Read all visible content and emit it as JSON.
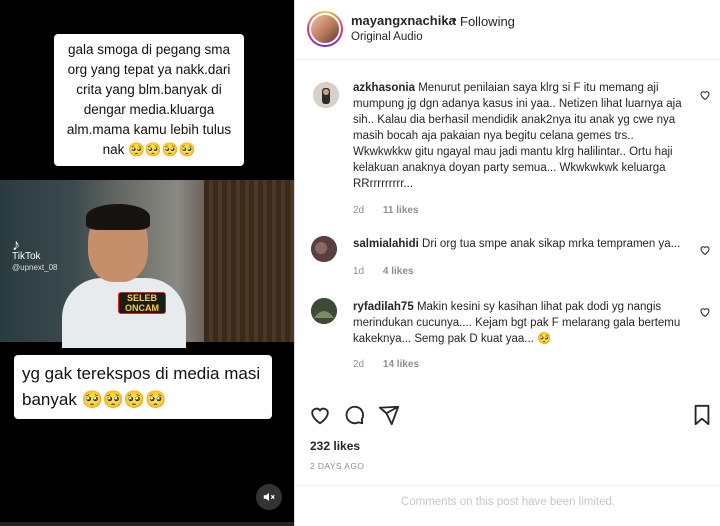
{
  "video": {
    "caption_top": "gala smoga di pegang sma org yang tepat ya nakk.dari crita yang blm.banyak di dengar media.kluarga alm.mama kamu lebih tulus nak 🥺🥺🥺🥺",
    "caption_bottom": "yg gak terekspos di media masi banyak 🥺🥺🥺🥺",
    "tiktok_label": "TikTok",
    "tiktok_user": "@upnext_08",
    "badge_line1": "SELEB",
    "badge_line2": "ONCAM",
    "mute_icon": "speaker-muted-icon"
  },
  "post": {
    "username": "mayangxnachika",
    "separator": "•",
    "follow_status": "Following",
    "audio": "Original Audio"
  },
  "comments": [
    {
      "username": "azkhasonia",
      "text": "Menurut penilaian saya klrg si F itu memang aji mumpung jg dgn adanya kasus ini yaa.. Netizen lihat luarnya aja sih.. Kalau dia berhasil mendidik anak2nya itu anak yg cwe nya masih bocah aja pakaian nya begitu celana gemes trs.. Wkwkwkkw gitu ngayal mau jadi mantu klrg halilintar.. Ortu haji kelakuan anaknya doyan party semua... Wkwkwkwk keluarga RRrrrrrrrrr...",
      "age": "2d",
      "likes": "11 likes",
      "avatar_color": "#c9b9a8"
    },
    {
      "username": "salmialahidi",
      "text": "Dri org tua smpe anak sikap mrka tempramen ya...",
      "age": "1d",
      "likes": "4 likes",
      "avatar_color": "#7a5a5a"
    },
    {
      "username": "ryfadilah75",
      "text": "Makin kesini sy kasihan lihat pak dodi yg nangis merindukan cucunya.... Kejam bgt pak F melarang gala bertemu kakeknya... Semg pak D kuat yaa... 🥺",
      "age": "2d",
      "likes": "14 likes",
      "avatar_color": "#5d6b4f"
    }
  ],
  "engagement": {
    "likes": "232 likes",
    "date": "2 DAYS AGO",
    "limited_notice": "Comments on this post have been limited."
  }
}
